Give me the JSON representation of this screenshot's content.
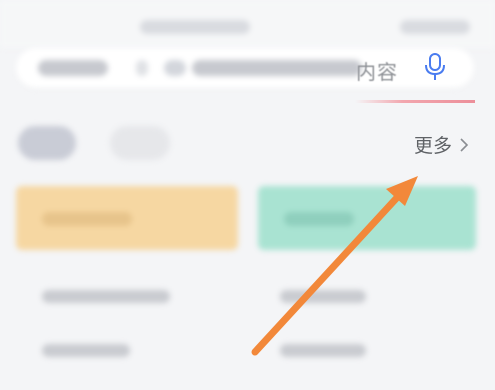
{
  "search": {
    "placeholder_visible": "内容",
    "icon": "microphone-icon"
  },
  "section": {
    "more_label": "更多",
    "more_icon": "chevron-right-icon"
  },
  "cards": [
    {
      "color": "#f6d7a2"
    },
    {
      "color": "#a9e3d2"
    }
  ],
  "annotation": {
    "arrow_color": "#f2883a",
    "icon": "pointer-arrow-icon"
  }
}
